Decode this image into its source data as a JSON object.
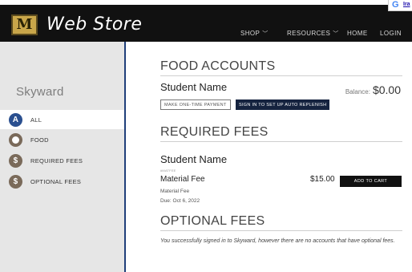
{
  "header": {
    "title": "Web Store",
    "logo_letter": "M",
    "nav": {
      "shop": "SHOP",
      "resources": "RESOURCES",
      "home": "HOME",
      "login": "LOGIN"
    },
    "translate": {
      "g": "G",
      "link": "Ira"
    }
  },
  "sidebar": {
    "title": "Skyward",
    "items": [
      {
        "label": "ALL",
        "icon": "A",
        "active": true
      },
      {
        "label": "FOOD",
        "icon": "food-icon"
      },
      {
        "label": "REQUIRED FEES",
        "icon": "$"
      },
      {
        "label": "OPTIONAL FEES",
        "icon": "$"
      }
    ]
  },
  "food": {
    "title": "FOOD ACCOUNTS",
    "student": "Student Name",
    "balance_label": "Balance:",
    "balance_value": "$0.00",
    "btn_one_time": "MAKE ONE-TIME PAYMENT",
    "btn_auto": "SIGN IN TO SET UP AUTO REPLENISH"
  },
  "required": {
    "title": "REQUIRED FEES",
    "student": "Student Name",
    "tag": "#MATFEE",
    "fee_name": "Material Fee",
    "fee_detail": "Material Fee",
    "fee_due": "Due: Oct 6, 2022",
    "fee_amount": "$15.00",
    "add_to_cart": "ADD TO CART"
  },
  "optional": {
    "title": "OPTIONAL FEES",
    "message": "You successfully signed in to Skyward, however there are no accounts that have optional fees."
  },
  "colors": {
    "header_bg": "#111111",
    "sidebar_bg": "#e6e6e6",
    "accent_blue": "#1f3f7a",
    "dark_button": "#15233f"
  }
}
